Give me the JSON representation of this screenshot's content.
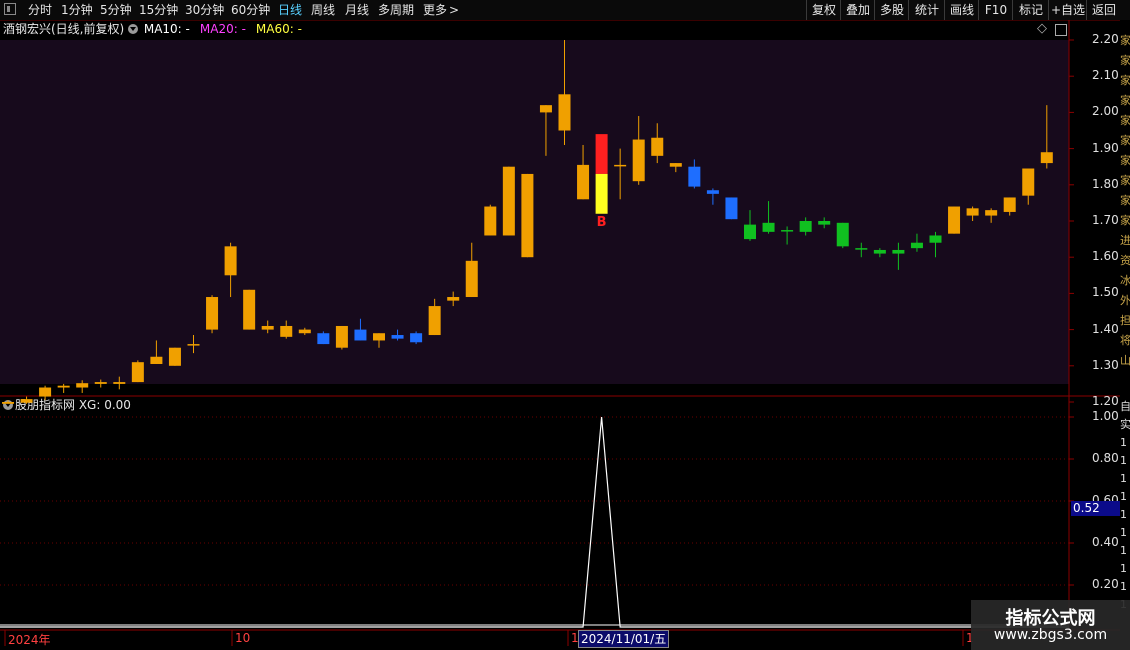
{
  "toolbar": {
    "left": [
      "分时",
      "1分钟",
      "5分钟",
      "15分钟",
      "30分钟",
      "60分钟",
      "日线",
      "周线",
      "月线",
      "多周期",
      "更多"
    ],
    "active": "日线",
    "more_arrow": ">",
    "right": [
      "复权",
      "叠加",
      "多股",
      "统计",
      "画线",
      "F10",
      "标记",
      "+自选",
      "返回"
    ]
  },
  "price_panel": {
    "title": "酒钢宏兴(日线,前复权)",
    "ma": [
      {
        "label": "MA10: -",
        "color": "#ffffff"
      },
      {
        "label": "MA20: -",
        "color": "#ff40ff"
      },
      {
        "label": "MA60: -",
        "color": "#ffff40"
      }
    ],
    "diamond": "◇",
    "ticks": [
      "2.20",
      "2.10",
      "2.00",
      "1.90",
      "1.80",
      "1.70",
      "1.60",
      "1.50",
      "1.40",
      "1.30",
      "1.20"
    ],
    "buy_marker": "B"
  },
  "indicator_panel": {
    "title": "股朋指标网 XG: 0.00",
    "ticks": [
      "1.00",
      "0.80",
      "0.60",
      "0.40",
      "0.20"
    ],
    "current_value": "0.52"
  },
  "time_axis": {
    "labels": [
      "2024年",
      "10",
      "1",
      "1"
    ],
    "selected_date": "2024/11/01/五"
  },
  "right_strip": {
    "chars": [
      "家",
      "家",
      "家",
      "家",
      "家",
      "家",
      "家",
      "家",
      "家",
      "家",
      "进",
      "资",
      "冰",
      "外",
      "担",
      "将",
      "山"
    ],
    "chars2": [
      "自",
      "实",
      "1",
      "1",
      "1",
      "1",
      "1",
      "1",
      "1",
      "1",
      "1",
      "1"
    ]
  },
  "watermark": {
    "title": "指标公式网",
    "url": "www.zbgs3.com"
  },
  "colors": {
    "up": "#f0a000",
    "down_blue": "#1e6eff",
    "down_green": "#10c020",
    "buy_red": "#ff2020",
    "buy_yellow": "#ffff20",
    "grid_red": "#8b0000",
    "price_bg": "#1a0a1e"
  },
  "candles": [
    {
      "o": 1.195,
      "h": 1.205,
      "l": 1.195,
      "c": 1.2,
      "t": "u"
    },
    {
      "o": 1.198,
      "h": 1.215,
      "l": 1.195,
      "c": 1.208,
      "t": "u"
    },
    {
      "o": 1.215,
      "h": 1.245,
      "l": 1.205,
      "c": 1.24,
      "t": "u"
    },
    {
      "o": 1.24,
      "h": 1.25,
      "l": 1.225,
      "c": 1.245,
      "t": "u"
    },
    {
      "o": 1.24,
      "h": 1.26,
      "l": 1.225,
      "c": 1.252,
      "t": "u"
    },
    {
      "o": 1.25,
      "h": 1.262,
      "l": 1.24,
      "c": 1.255,
      "t": "u"
    },
    {
      "o": 1.25,
      "h": 1.27,
      "l": 1.235,
      "c": 1.255,
      "t": "u"
    },
    {
      "o": 1.255,
      "h": 1.315,
      "l": 1.255,
      "c": 1.31,
      "t": "u"
    },
    {
      "o": 1.305,
      "h": 1.37,
      "l": 1.305,
      "c": 1.325,
      "t": "u"
    },
    {
      "o": 1.3,
      "h": 1.35,
      "l": 1.3,
      "c": 1.35,
      "t": "u"
    },
    {
      "o": 1.36,
      "h": 1.385,
      "l": 1.335,
      "c": 1.36,
      "t": "u"
    },
    {
      "o": 1.4,
      "h": 1.495,
      "l": 1.39,
      "c": 1.49,
      "t": "u"
    },
    {
      "o": 1.55,
      "h": 1.64,
      "l": 1.49,
      "c": 1.63,
      "t": "u"
    },
    {
      "o": 1.51,
      "h": 1.51,
      "l": 1.4,
      "c": 1.4,
      "t": "u"
    },
    {
      "o": 1.4,
      "h": 1.425,
      "l": 1.39,
      "c": 1.41,
      "t": "u"
    },
    {
      "o": 1.41,
      "h": 1.425,
      "l": 1.375,
      "c": 1.38,
      "t": "u"
    },
    {
      "o": 1.39,
      "h": 1.405,
      "l": 1.385,
      "c": 1.4,
      "t": "u"
    },
    {
      "o": 1.39,
      "h": 1.395,
      "l": 1.36,
      "c": 1.36,
      "t": "b"
    },
    {
      "o": 1.35,
      "h": 1.41,
      "l": 1.345,
      "c": 1.41,
      "t": "u"
    },
    {
      "o": 1.4,
      "h": 1.43,
      "l": 1.37,
      "c": 1.37,
      "t": "b"
    },
    {
      "o": 1.37,
      "h": 1.39,
      "l": 1.35,
      "c": 1.39,
      "t": "u"
    },
    {
      "o": 1.385,
      "h": 1.4,
      "l": 1.37,
      "c": 1.375,
      "t": "b"
    },
    {
      "o": 1.39,
      "h": 1.395,
      "l": 1.36,
      "c": 1.365,
      "t": "b"
    },
    {
      "o": 1.385,
      "h": 1.485,
      "l": 1.385,
      "c": 1.465,
      "t": "u"
    },
    {
      "o": 1.48,
      "h": 1.505,
      "l": 1.465,
      "c": 1.49,
      "t": "u"
    },
    {
      "o": 1.49,
      "h": 1.64,
      "l": 1.49,
      "c": 1.59,
      "t": "u"
    },
    {
      "o": 1.66,
      "h": 1.745,
      "l": 1.66,
      "c": 1.74,
      "t": "u"
    },
    {
      "o": 1.66,
      "h": 1.85,
      "l": 1.66,
      "c": 1.85,
      "t": "u"
    },
    {
      "o": 1.6,
      "h": 1.83,
      "l": 1.6,
      "c": 1.83,
      "t": "u"
    },
    {
      "o": 2.0,
      "h": 2.02,
      "l": 1.88,
      "c": 2.02,
      "t": "u"
    },
    {
      "o": 1.95,
      "h": 2.2,
      "l": 1.91,
      "c": 2.05,
      "t": "u"
    },
    {
      "o": 1.76,
      "h": 1.91,
      "l": 1.76,
      "c": 1.855,
      "t": "u"
    },
    {
      "o": 1.72,
      "h": 1.94,
      "l": 1.72,
      "c": 1.94,
      "t": "buy"
    },
    {
      "o": 1.855,
      "h": 1.9,
      "l": 1.76,
      "c": 1.855,
      "t": "u"
    },
    {
      "o": 1.81,
      "h": 1.99,
      "l": 1.8,
      "c": 1.925,
      "t": "u"
    },
    {
      "o": 1.88,
      "h": 1.97,
      "l": 1.86,
      "c": 1.93,
      "t": "u"
    },
    {
      "o": 1.86,
      "h": 1.86,
      "l": 1.835,
      "c": 1.85,
      "t": "u"
    },
    {
      "o": 1.85,
      "h": 1.87,
      "l": 1.79,
      "c": 1.795,
      "t": "b"
    },
    {
      "o": 1.785,
      "h": 1.79,
      "l": 1.745,
      "c": 1.775,
      "t": "b"
    },
    {
      "o": 1.765,
      "h": 1.765,
      "l": 1.705,
      "c": 1.705,
      "t": "b"
    },
    {
      "o": 1.69,
      "h": 1.73,
      "l": 1.645,
      "c": 1.65,
      "t": "g"
    },
    {
      "o": 1.695,
      "h": 1.755,
      "l": 1.665,
      "c": 1.67,
      "t": "g"
    },
    {
      "o": 1.675,
      "h": 1.685,
      "l": 1.635,
      "c": 1.675,
      "t": "g"
    },
    {
      "o": 1.7,
      "h": 1.71,
      "l": 1.66,
      "c": 1.67,
      "t": "g"
    },
    {
      "o": 1.7,
      "h": 1.71,
      "l": 1.68,
      "c": 1.69,
      "t": "g"
    },
    {
      "o": 1.695,
      "h": 1.695,
      "l": 1.625,
      "c": 1.63,
      "t": "g"
    },
    {
      "o": 1.625,
      "h": 1.64,
      "l": 1.6,
      "c": 1.625,
      "t": "g"
    },
    {
      "o": 1.62,
      "h": 1.625,
      "l": 1.6,
      "c": 1.61,
      "t": "g"
    },
    {
      "o": 1.62,
      "h": 1.64,
      "l": 1.565,
      "c": 1.61,
      "t": "g"
    },
    {
      "o": 1.64,
      "h": 1.665,
      "l": 1.615,
      "c": 1.625,
      "t": "g"
    },
    {
      "o": 1.66,
      "h": 1.67,
      "l": 1.6,
      "c": 1.64,
      "t": "g"
    },
    {
      "o": 1.665,
      "h": 1.74,
      "l": 1.665,
      "c": 1.74,
      "t": "u"
    },
    {
      "o": 1.715,
      "h": 1.74,
      "l": 1.7,
      "c": 1.735,
      "t": "u"
    },
    {
      "o": 1.715,
      "h": 1.735,
      "l": 1.695,
      "c": 1.73,
      "t": "u"
    },
    {
      "o": 1.725,
      "h": 1.765,
      "l": 1.715,
      "c": 1.765,
      "t": "u"
    },
    {
      "o": 1.77,
      "h": 1.845,
      "l": 1.745,
      "c": 1.845,
      "t": "u"
    },
    {
      "o": 1.86,
      "h": 2.02,
      "l": 1.845,
      "c": 1.89,
      "t": "u"
    }
  ],
  "indicator_series": {
    "peak_index": 32
  }
}
